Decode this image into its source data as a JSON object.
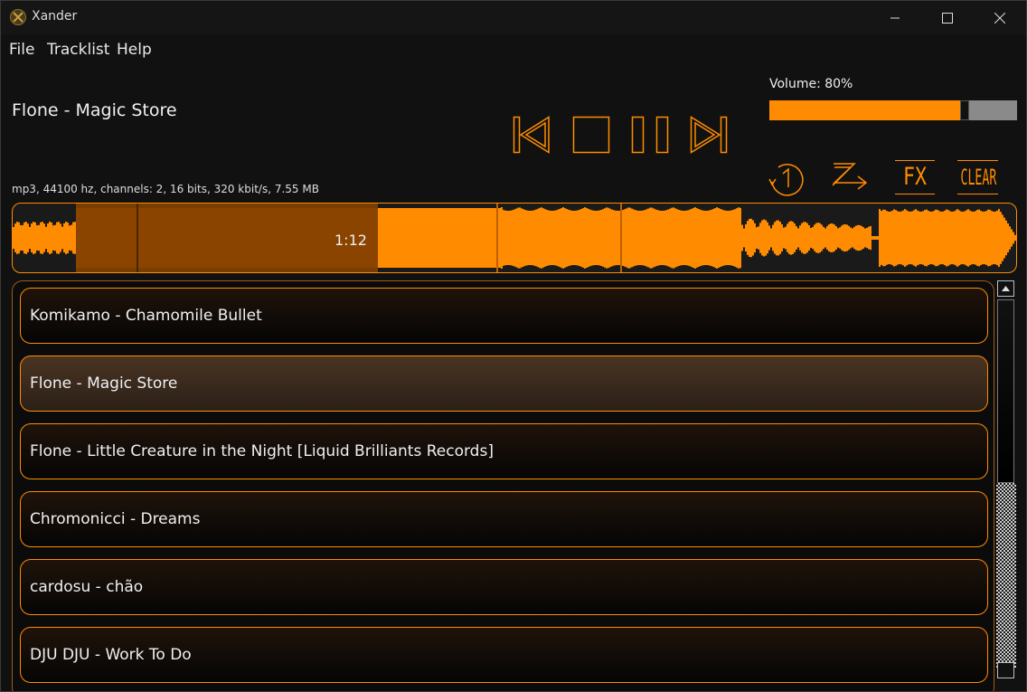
{
  "window": {
    "title": "Xander",
    "icon": "xander-logo-icon",
    "minimize_icon": "minimize-icon",
    "maximize_icon": "maximize-icon",
    "close_icon": "close-icon"
  },
  "menu": {
    "items": [
      "File",
      "Tracklist",
      "Help"
    ]
  },
  "now_playing": {
    "title": "Flone - Magic Store",
    "info": "mp3, 44100 hz, channels: 2, 16 bits, 320 kbit/s, 7.55 MB"
  },
  "transport": {
    "buttons": [
      "previous-icon",
      "stop-icon",
      "pause-icon",
      "next-icon"
    ]
  },
  "volume": {
    "label": "Volume: 80%",
    "level": 0.8
  },
  "options": {
    "repeat_one_icon": "repeat-one-icon",
    "shuffle_icon": "shuffle-icon",
    "fx_label": "FX",
    "clear_label": "CLEAR"
  },
  "waveform": {
    "position_label": "1:12",
    "played_fraction": 0.364
  },
  "tracklist": {
    "tracks": [
      "Komikamo - Chamomile Bullet",
      "Flone - Magic Store",
      "Flone - Little Creature in the Night [Liquid Brilliants Records]",
      "Chromonicci - Dreams",
      "cardosu - chão",
      "DJU DJU - Work To Do"
    ],
    "active_index": 1
  },
  "colors": {
    "accent": "#ff8c00",
    "played": "#7a3d00",
    "background": "#111111"
  }
}
